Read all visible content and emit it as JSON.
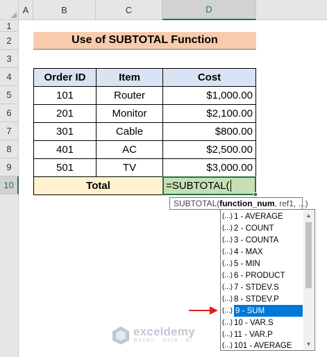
{
  "sheet": {
    "columns": [
      "A",
      "B",
      "C",
      "D"
    ],
    "rows": [
      "1",
      "2",
      "3",
      "4",
      "5",
      "6",
      "7",
      "8",
      "9",
      "10"
    ],
    "selected_column": "D",
    "selected_row": "10"
  },
  "title": "Use of SUBTOTAL Function",
  "table": {
    "headers": [
      "Order ID",
      "Item",
      "Cost"
    ],
    "rows": [
      [
        "101",
        "Router",
        "$1,000.00"
      ],
      [
        "201",
        "Monitor",
        "$2,100.00"
      ],
      [
        "301",
        "Cable",
        "$800.00"
      ],
      [
        "401",
        "AC",
        "$2,500.00"
      ],
      [
        "501",
        "TV",
        "$3,000.00"
      ]
    ],
    "total_label": "Total",
    "formula_input": "=SUBTOTAL("
  },
  "tooltip": {
    "func": "SUBTOTAL(",
    "arg_bold": "function_num",
    "rest": ", ref1, ...)"
  },
  "dropdown": {
    "selected_index": 8,
    "items": [
      "1 - AVERAGE",
      "2 - COUNT",
      "3 - COUNTA",
      "4 - MAX",
      "5 - MIN",
      "6 - PRODUCT",
      "7 - STDEV.S",
      "8 - STDEV.P",
      "9 - SUM",
      "10 - VAR.S",
      "11 - VAR.P",
      "101 - AVERAGE"
    ],
    "item_icon": "(...)"
  },
  "watermark": {
    "name": "exceldemy",
    "tagline": "EXCEL · DATA · BI"
  },
  "colors": {
    "title_bg": "#f8cbad",
    "header_bg": "#dae3f3",
    "total_bg": "#fff2cc",
    "active_bg": "#c6e0b4",
    "selection_blue": "#0078d7",
    "arrow_red": "#e02020"
  }
}
